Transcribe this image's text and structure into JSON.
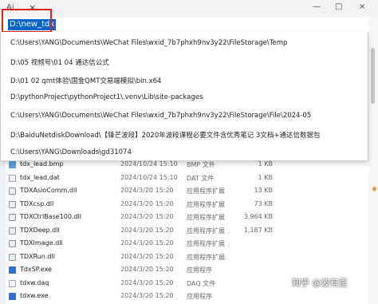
{
  "window": {
    "tab_fragment": "Ai",
    "tab_close": "×",
    "minimize": "—",
    "maximize": "□",
    "close": "×"
  },
  "address": {
    "value": "D:\\new_tdx"
  },
  "suggestions": [
    "C:\\Users\\YANG\\Documents\\WeChat Files\\wxid_7b7phxh9nv3y22\\FileStorage\\Temp",
    "D:\\05 视频号\\01 04 通达信公式",
    "D:\\01 02 qmt体验\\国金QMT交易端模拟\\bin.x64",
    "D:\\pythonProject\\pythonProject1\\.venv\\Lib\\site-packages",
    "C:\\Users\\YANG\\Documents\\WeChat Files\\wxid_7b7phxh9nv3y22\\FileStorage\\File\\2024-05",
    "D:\\BaiduNetdiskDownload\\【锋芒波段】2020年波段课程必要文件含优秀笔记  3文档+通达信数据包",
    "C:\\Users\\YANG\\Downloads\\gd31074"
  ],
  "files": [
    {
      "name": "tdx_lead.bmp",
      "date": "2024/10/24 15:10",
      "type": "BMP 文件",
      "size": "1 KB",
      "icon": "bmp"
    },
    {
      "name": "tdx_lead.dat",
      "date": "2024/10/24 15:10",
      "type": "DAT 文件",
      "size": "1 KB",
      "icon": "dat"
    },
    {
      "name": "TDXAsioComm.dll",
      "date": "2024/3/20 15:20",
      "type": "应用程序扩展",
      "size": "13 KB",
      "icon": "dll"
    },
    {
      "name": "TDXcsp.dll",
      "date": "2024/3/20 15:20",
      "type": "应用程序扩展",
      "size": "73 KB",
      "icon": "dll"
    },
    {
      "name": "TDXCtrlBase100.dll",
      "date": "2024/3/20 15:20",
      "type": "应用程序扩展",
      "size": "3,964 KB",
      "icon": "dll"
    },
    {
      "name": "TDXDeep.dll",
      "date": "2024/3/20 15:20",
      "type": "应用程序扩展",
      "size": "1,187 KB",
      "icon": "dll"
    },
    {
      "name": "TDXImage.dll",
      "date": "2024/3/20 15:20",
      "type": "应用程序扩展",
      "size": "",
      "icon": "dll"
    },
    {
      "name": "TDXRun.dll",
      "date": "2024/3/20 15:20",
      "type": "应用程序扩展",
      "size": "",
      "icon": "dll"
    },
    {
      "name": "TdxSP.exe",
      "date": "2024/3/20 15:20",
      "type": "应用程序",
      "size": "",
      "icon": "exe"
    },
    {
      "name": "tdxw.daq",
      "date": "2024/3/20 15:20",
      "type": "DAQ 文件",
      "size": "",
      "icon": "daq"
    },
    {
      "name": "tdxw.exe",
      "date": "2024/3/20 15:20",
      "type": "应用程序",
      "size": "",
      "icon": "exe"
    }
  ],
  "watermark": "知乎 @波有歪"
}
